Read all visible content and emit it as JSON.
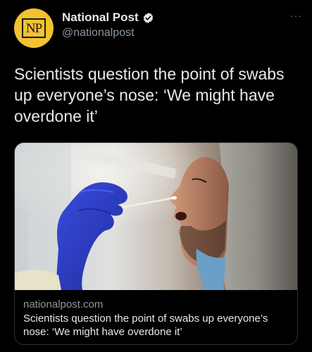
{
  "account": {
    "avatar_text": "NP",
    "display_name": "National Post",
    "handle": "@nationalpost",
    "verified": true,
    "avatar_color": "#f2c230"
  },
  "menu": {
    "more_label": "···"
  },
  "tweet": {
    "text": "Scientists question the point of swabs up everyone’s nose: ‘We might have overdone it’"
  },
  "card": {
    "domain": "nationalpost.com",
    "title": "Scientists question the point of swabs up everyone’s nose: ‘We might have overdone it’"
  },
  "colors": {
    "background": "#000000",
    "text_primary": "#e7e9ea",
    "text_secondary": "#8b98a5",
    "verified_badge": "#e7e9ea",
    "glove": "#2f3fd0"
  }
}
